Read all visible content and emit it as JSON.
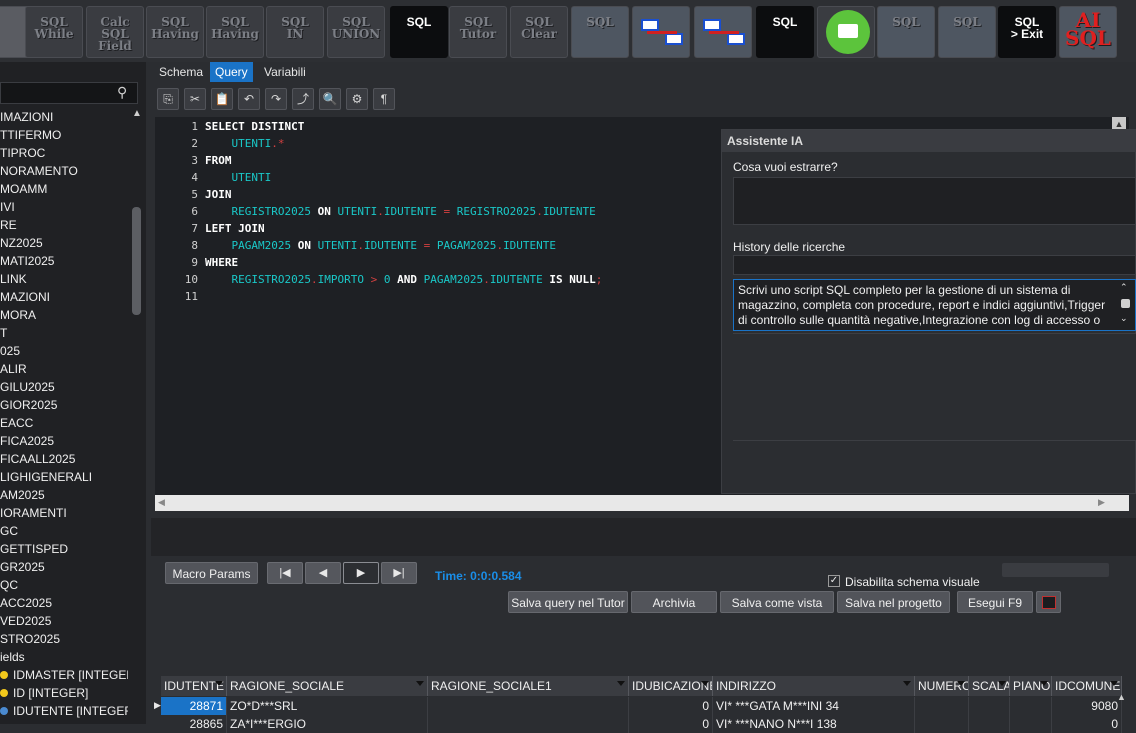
{
  "toolbar": {
    "buttons": [
      {
        "name": "db-icon",
        "label": ""
      },
      {
        "name": "sql-while-button",
        "label": "SQL\nWhile"
      },
      {
        "name": "calc-sql-field-button",
        "label": "Calc\nSQL\nField"
      },
      {
        "name": "sql-having-button",
        "label": "SQL\nHaving"
      },
      {
        "name": "sql-having2-button",
        "label": "SQL\nHaving"
      },
      {
        "name": "sql-in-button",
        "label": "SQL\nIN"
      },
      {
        "name": "sql-union-button",
        "label": "SQL\nUNION"
      },
      {
        "name": "sql-run-button",
        "label": "SQL"
      },
      {
        "name": "sql-tutor-button",
        "label": "SQL\nTutor"
      },
      {
        "name": "sql-clear-button",
        "label": "SQL\nClear"
      },
      {
        "name": "sql-script-button",
        "label": "SQL"
      },
      {
        "name": "add-join-button",
        "label": ""
      },
      {
        "name": "remove-join-button",
        "label": ""
      },
      {
        "name": "sql-sort-button",
        "label": "SQL"
      },
      {
        "name": "print-button",
        "label": ""
      },
      {
        "name": "sql-chart-button",
        "label": "SQL"
      },
      {
        "name": "sql-search-add-button",
        "label": "SQL"
      },
      {
        "name": "sql-exit-button",
        "label": "SQL\n> Exit"
      },
      {
        "name": "ai-sql-button",
        "label": "AI\nSQL"
      }
    ]
  },
  "left": {
    "search_placeholder": "",
    "tree": [
      "IMAZIONI",
      "TTIFERMO",
      "TIPROC",
      "NORAMENTO",
      "MOAMM",
      "IVI",
      "RE",
      "NZ2025",
      "MATI2025",
      "LINK",
      "MAZIONI",
      "MORA",
      "T",
      "025",
      "ALIR",
      "GILU2025",
      "GIOR2025",
      "EACC",
      "FICA2025",
      "FICAALL2025",
      "LIGHIGENERALI",
      "AM2025",
      "IORAMENTI",
      "GC",
      "GETTISPED",
      "GR2025",
      "QC",
      "ACC2025",
      "VED2025",
      "STRO2025",
      "ields"
    ],
    "fields": [
      "IDMASTER [INTEGER]",
      "ID [INTEGER]",
      "IDUTENTE [INTEGER]"
    ]
  },
  "tabs": [
    {
      "label": "Schema"
    },
    {
      "label": "Query"
    },
    {
      "label": "Variabili"
    }
  ],
  "editor_tools": [
    "⎘",
    "✂",
    "📋",
    "↶",
    "↷",
    "⤴",
    "🔍",
    "⚙",
    "¶"
  ],
  "editor": {
    "line_numbers": [
      "1",
      "2",
      "3",
      "4",
      "5",
      "6",
      "7",
      "8",
      "9",
      "10",
      "11"
    ],
    "lines": [
      [
        {
          "t": "SELECT DISTINCT",
          "c": "kw"
        }
      ],
      [
        {
          "t": "    UTENTI",
          "c": "id"
        },
        {
          "t": ".*",
          "c": "op"
        }
      ],
      [
        {
          "t": "FROM",
          "c": "kw"
        }
      ],
      [
        {
          "t": "    UTENTI",
          "c": "id"
        }
      ],
      [
        {
          "t": "JOIN",
          "c": "kw"
        }
      ],
      [
        {
          "t": "    REGISTRO2025",
          "c": "id"
        },
        {
          "t": " ON ",
          "c": "kw"
        },
        {
          "t": "UTENTI",
          "c": "id"
        },
        {
          "t": ".",
          "c": "op"
        },
        {
          "t": "IDUTENTE",
          "c": "id"
        },
        {
          "t": " = ",
          "c": "op"
        },
        {
          "t": "REGISTRO2025",
          "c": "id"
        },
        {
          "t": ".",
          "c": "op"
        },
        {
          "t": "IDUTENTE",
          "c": "id"
        }
      ],
      [
        {
          "t": "LEFT JOIN",
          "c": "kw"
        }
      ],
      [
        {
          "t": "    PAGAM2025",
          "c": "id"
        },
        {
          "t": " ON ",
          "c": "kw"
        },
        {
          "t": "UTENTI",
          "c": "id"
        },
        {
          "t": ".",
          "c": "op"
        },
        {
          "t": "IDUTENTE",
          "c": "id"
        },
        {
          "t": " = ",
          "c": "op"
        },
        {
          "t": "PAGAM2025",
          "c": "id"
        },
        {
          "t": ".",
          "c": "op"
        },
        {
          "t": "IDUTENTE",
          "c": "id"
        }
      ],
      [
        {
          "t": "WHERE",
          "c": "kw"
        }
      ],
      [
        {
          "t": "    REGISTRO2025",
          "c": "id"
        },
        {
          "t": ".",
          "c": "op"
        },
        {
          "t": "IMPORTO",
          "c": "id"
        },
        {
          "t": " > ",
          "c": "op"
        },
        {
          "t": "0",
          "c": "id"
        },
        {
          "t": " AND ",
          "c": "kw"
        },
        {
          "t": "PAGAM2025",
          "c": "id"
        },
        {
          "t": ".",
          "c": "op"
        },
        {
          "t": "IDUTENTE",
          "c": "id"
        },
        {
          "t": " IS NULL",
          "c": "kw"
        },
        {
          "t": ";",
          "c": "op"
        }
      ],
      []
    ]
  },
  "ai_panel": {
    "title": "Assistente IA",
    "question_label": "Cosa vuoi estrarre?",
    "question_value": "",
    "history_label": "History delle ricerche",
    "history_filter": "",
    "history_item": "Scrivi uno script SQL completo per la gestione di un sistema di magazzino, completa con procedure, report e indici aggiuntivi,Trigger di controllo sulle quantità negative,Integrazione con log di accesso o"
  },
  "controls": {
    "macro_params": "Macro Params",
    "nav": [
      "|◀",
      "◀",
      "▶",
      "▶|"
    ],
    "time": "Time: 0:0:0.584",
    "disable_visual_schema": "Disabilita schema visuale",
    "disable_visual_schema_checked": true,
    "save_tutor": "Salva query nel Tutor",
    "archive": "Archivia",
    "save_view": "Salva come vista",
    "save_project": "Salva nel progetto",
    "execute": "Esegui F9"
  },
  "grid": {
    "columns": [
      "IDUTENTE",
      "RAGIONE_SOCIALE",
      "RAGIONE_SOCIALE1",
      "IDUBICAZIONE",
      "INDIRIZZO",
      "NUMERO",
      "SCALA",
      "PIANO",
      "IDCOMUNE"
    ],
    "rows": [
      [
        "28871",
        "ZO*D***SRL",
        "",
        "0",
        "VI* ***GATA M***INI 34",
        "",
        "",
        "",
        "9080"
      ],
      [
        "28865",
        "ZA*I***ERGIO",
        "",
        "0",
        "VI* ***NANO N***I 138",
        "",
        "",
        "",
        "0"
      ]
    ]
  }
}
